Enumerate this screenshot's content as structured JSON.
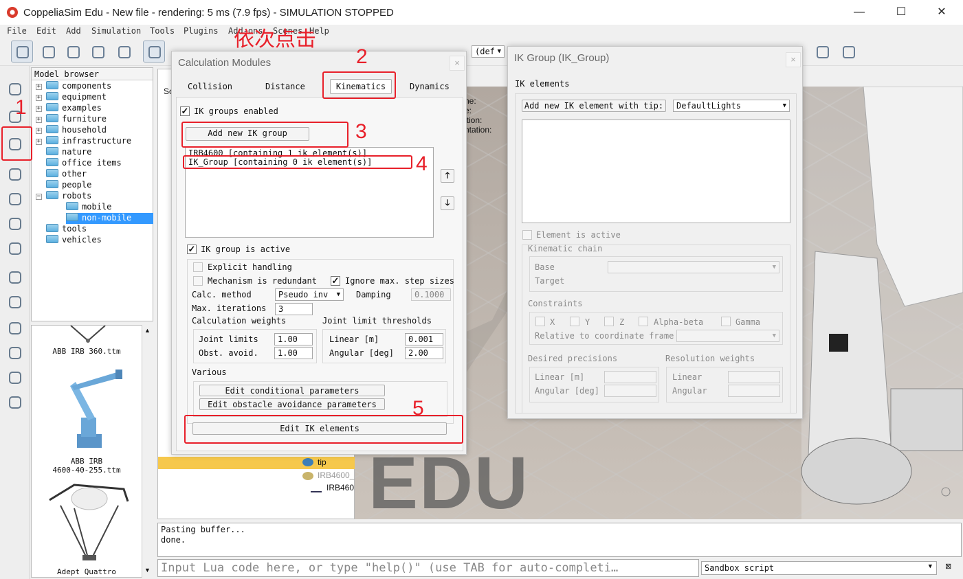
{
  "window": {
    "title": "CoppeliaSim Edu - New file - rendering: 5 ms (7.9 fps) - SIMULATION STOPPED",
    "minimize": "—",
    "maximize": "☐",
    "close": "✕"
  },
  "menu": [
    "File",
    "Edit",
    "Add",
    "Simulation",
    "Tools",
    "Plugins",
    "Add-ons",
    "Scenes",
    "Help"
  ],
  "toolbar": {
    "view_combo": "(def"
  },
  "model_browser": {
    "header": "Model browser",
    "items": [
      {
        "label": "components",
        "expander": "+"
      },
      {
        "label": "equipment",
        "expander": "+"
      },
      {
        "label": "examples",
        "expander": "+"
      },
      {
        "label": "furniture",
        "expander": "+"
      },
      {
        "label": "household",
        "expander": "+"
      },
      {
        "label": "infrastructure",
        "expander": "+"
      },
      {
        "label": "nature",
        "expander": ""
      },
      {
        "label": "office items",
        "expander": ""
      },
      {
        "label": "other",
        "expander": ""
      },
      {
        "label": "people",
        "expander": ""
      },
      {
        "label": "robots",
        "expander": "−"
      },
      {
        "label": "mobile",
        "expander": ""
      },
      {
        "label": "non-mobile",
        "expander": ""
      },
      {
        "label": "tools",
        "expander": ""
      },
      {
        "label": "vehicles",
        "expander": ""
      }
    ]
  },
  "thumbnails": [
    {
      "label": "ABB IRB 360.ttm"
    },
    {
      "label": "ABB IRB\n4600-40-255.ttm"
    },
    {
      "label": "Adept Quattro"
    }
  ],
  "hierarchy": {
    "tab": "Sc",
    "nodes": [
      "tip",
      "IRB4600_",
      "IRB460"
    ]
  },
  "scene_labels": [
    "ne:",
    "e:",
    "ition:",
    "ntation:"
  ],
  "watermark": "EDU",
  "console": {
    "lines": [
      "Pasting buffer...",
      "done."
    ],
    "input_placeholder": "Input Lua code here, or type \"help()\" (use TAB for auto-completi…",
    "script_select": "Sandbox script"
  },
  "calc_modules": {
    "title": "Calculation Modules",
    "close": "×",
    "tabs": [
      "Collision",
      "Distance",
      "Kinematics",
      "Dynamics"
    ],
    "ik_groups_enabled": "IK groups enabled",
    "add_group_button": "Add new IK group",
    "groups": [
      "IRB4600 [containing 1 ik element(s)]",
      "IK_Group [containing 0 ik element(s)]"
    ],
    "up_arrow": "🡑",
    "down_arrow": "🡓",
    "group_active": "IK group is active",
    "explicit_handling": "Explicit handling",
    "mechanism_redundant": "Mechanism is redundant",
    "ignore_max_step": "Ignore max. step sizes",
    "calc_method_label": "Calc. method",
    "calc_method_value": "Pseudo inv",
    "damping_label": "Damping",
    "damping_value": "0.1000",
    "max_iter_label": "Max. iterations",
    "max_iter_value": "3",
    "calc_weights_label": "Calculation weights",
    "joint_limit_thr_label": "Joint limit thresholds",
    "joint_limits_label": "Joint limits",
    "joint_limits_value": "1.00",
    "obst_avoid_label": "Obst. avoid.",
    "obst_avoid_value": "1.00",
    "linear_label": "Linear [m]",
    "linear_value": "0.001",
    "angular_label": "Angular [deg]",
    "angular_value": "2.00",
    "various_label": "Various",
    "edit_conditional": "Edit conditional parameters",
    "edit_obstacle": "Edit obstacle avoidance parameters",
    "edit_ik_elements": "Edit IK elements"
  },
  "ik_group": {
    "title": "IK Group (IK_Group)",
    "close": "×",
    "ik_elements_label": "IK elements",
    "add_element_button": "Add new IK element with tip:",
    "tip_select": "DefaultLights",
    "element_active": "Element is active",
    "kin_chain_label": "Kinematic chain",
    "base_label": "Base",
    "target_label": "Target",
    "constraints_label": "Constraints",
    "c_x": "X",
    "c_y": "Y",
    "c_z": "Z",
    "c_alpha": "Alpha-beta",
    "c_gamma": "Gamma",
    "relative_frame_label": "Relative to coordinate frame",
    "desired_prec_label": "Desired precisions",
    "res_weights_label": "Resolution weights",
    "prec_linear": "Linear [m]",
    "prec_angular": "Angular [deg]",
    "w_linear": "Linear",
    "w_angular": "Angular"
  },
  "annotations": {
    "title": "依次点击",
    "n1": "1",
    "n2": "2",
    "n3": "3",
    "n4": "4",
    "n5": "5",
    "color": "#e8202a"
  }
}
